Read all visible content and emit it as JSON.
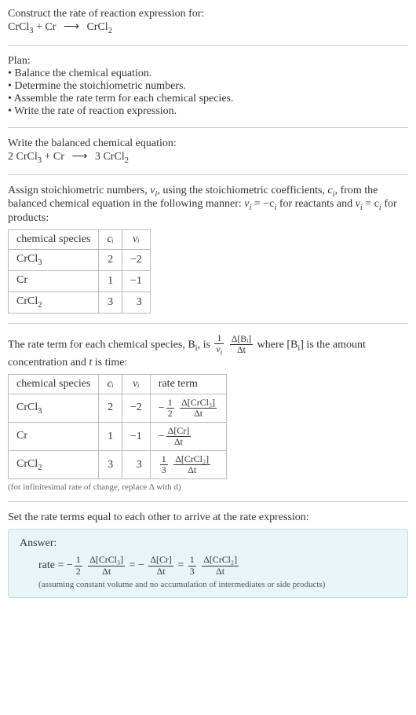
{
  "prompt": {
    "title": "Construct the rate of reaction expression for:",
    "equation_left1": "CrCl",
    "equation_left1_sub": "3",
    "equation_plus": " + Cr",
    "equation_arrow": "⟶",
    "equation_right1": "CrCl",
    "equation_right1_sub": "2"
  },
  "plan": {
    "heading": "Plan:",
    "b1": "• Balance the chemical equation.",
    "b2": "• Determine the stoichiometric numbers.",
    "b3": "• Assemble the rate term for each chemical species.",
    "b4": "• Write the rate of reaction expression."
  },
  "balanced": {
    "heading": "Write the balanced chemical equation:",
    "c1": "2 CrCl",
    "c1_sub": "3",
    "plus": " + Cr",
    "arrow": "⟶",
    "c2": "3 CrCl",
    "c2_sub": "2"
  },
  "stoich": {
    "text1": "Assign stoichiometric numbers, ",
    "nu": "ν",
    "nu_sub": "i",
    "text2": ", using the stoichiometric coefficients, ",
    "c": "c",
    "c_sub": "i",
    "text3": ", from the balanced chemical equation in the following manner: ",
    "eq1": "ν",
    "eq1_sub": "i",
    "eq1_mid": " = −c",
    "eq1_sub2": "i",
    "text4": " for reactants and ",
    "eq2": "ν",
    "eq2_sub": "i",
    "eq2_mid": " = c",
    "eq2_sub2": "i",
    "text5": " for products:",
    "table": {
      "h1": "chemical species",
      "h2": "cᵢ",
      "h3": "νᵢ",
      "rows": [
        {
          "sp": "CrCl",
          "sp_sub": "3",
          "c": "2",
          "nu": "−2"
        },
        {
          "sp": "Cr",
          "sp_sub": "",
          "c": "1",
          "nu": "−1"
        },
        {
          "sp": "CrCl",
          "sp_sub": "2",
          "c": "3",
          "nu": "3"
        }
      ]
    }
  },
  "rate_term": {
    "text1": "The rate term for each chemical species, B",
    "text1_sub": "i",
    "text2": ", is ",
    "frac1_num": "1",
    "frac1_den_a": "ν",
    "frac1_den_sub": "i",
    "frac2_num": "Δ[Bᵢ]",
    "frac2_den": "Δt",
    "text3": " where [B",
    "text3_sub": "i",
    "text4": "] is the amount concentration and ",
    "t_var": "t",
    "text5": " is time:",
    "table": {
      "h1": "chemical species",
      "h2": "cᵢ",
      "h3": "νᵢ",
      "h4": "rate term",
      "rows": [
        {
          "sp": "CrCl",
          "sp_sub": "3",
          "c": "2",
          "nu": "−2",
          "neg": "−",
          "f1n": "1",
          "f1d": "2",
          "f2n": "Δ[CrCl₃]",
          "f2d": "Δt"
        },
        {
          "sp": "Cr",
          "sp_sub": "",
          "c": "1",
          "nu": "−1",
          "neg": "−",
          "f1n": "",
          "f1d": "",
          "f2n": "Δ[Cr]",
          "f2d": "Δt"
        },
        {
          "sp": "CrCl",
          "sp_sub": "2",
          "c": "3",
          "nu": "3",
          "neg": "",
          "f1n": "1",
          "f1d": "3",
          "f2n": "Δ[CrCl₂]",
          "f2d": "Δt"
        }
      ]
    },
    "note": "(for infinitesimal rate of change, replace Δ with d)"
  },
  "final": {
    "heading": "Set the rate terms equal to each other to arrive at the rate expression:",
    "answer_label": "Answer:",
    "rate_eq_prefix": "rate = −",
    "f1n": "1",
    "f1d": "2",
    "f2n": "Δ[CrCl₃]",
    "f2d": "Δt",
    "eq": " = −",
    "f3n": "Δ[Cr]",
    "f3d": "Δt",
    "eq2": " = ",
    "f4n": "1",
    "f4d": "3",
    "f5n": "Δ[CrCl₂]",
    "f5d": "Δt",
    "note": "(assuming constant volume and no accumulation of intermediates or side products)"
  },
  "chart_data": {
    "type": "table",
    "tables": [
      {
        "title": "stoichiometric numbers",
        "columns": [
          "chemical species",
          "c_i",
          "nu_i"
        ],
        "rows": [
          [
            "CrCl3",
            2,
            -2
          ],
          [
            "Cr",
            1,
            -1
          ],
          [
            "CrCl2",
            3,
            3
          ]
        ]
      },
      {
        "title": "rate terms",
        "columns": [
          "chemical species",
          "c_i",
          "nu_i",
          "rate term"
        ],
        "rows": [
          [
            "CrCl3",
            2,
            -2,
            "-(1/2) Δ[CrCl3]/Δt"
          ],
          [
            "Cr",
            1,
            -1,
            "-Δ[Cr]/Δt"
          ],
          [
            "CrCl2",
            3,
            3,
            "(1/3) Δ[CrCl2]/Δt"
          ]
        ]
      }
    ],
    "balanced_equation": "2 CrCl3 + Cr -> 3 CrCl2",
    "rate_expression": "rate = -(1/2) Δ[CrCl3]/Δt = -Δ[Cr]/Δt = (1/3) Δ[CrCl2]/Δt"
  }
}
